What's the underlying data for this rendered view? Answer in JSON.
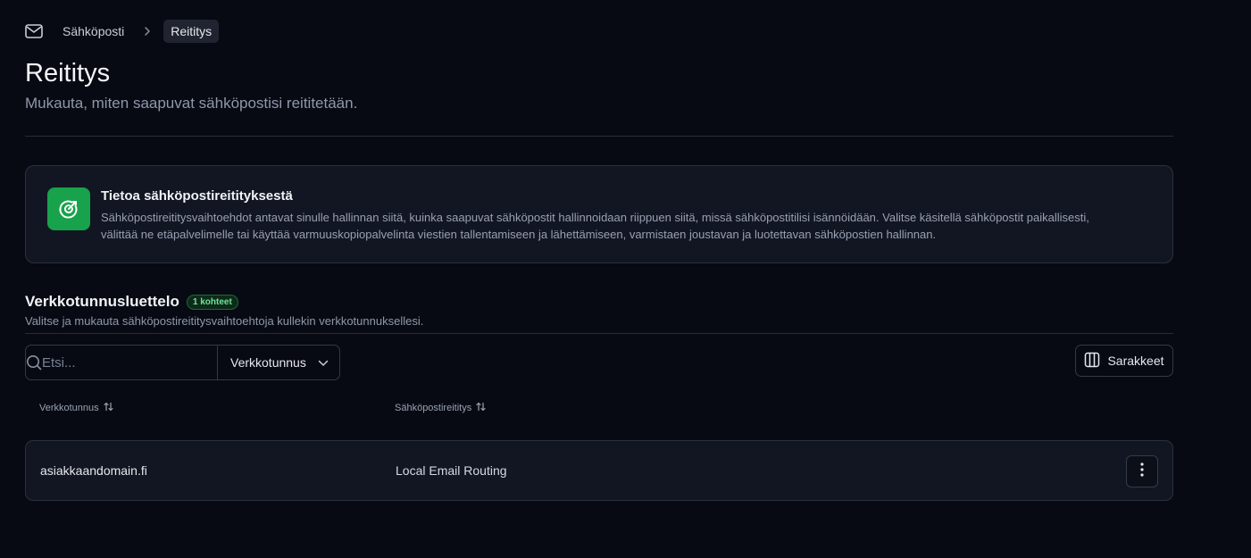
{
  "breadcrumb": {
    "icon": "mail-icon",
    "parent": "Sähköposti",
    "current": "Reititys"
  },
  "header": {
    "title": "Reititys",
    "subtitle": "Mukauta, miten saapuvat sähköpostisi reititetään."
  },
  "info": {
    "icon": "target-icon",
    "title": "Tietoa sähköpostireitityksestä",
    "text": "Sähköpostireititysvaihtoehdot antavat sinulle hallinnan siitä, kuinka saapuvat sähköpostit hallinnoidaan riippuen siitä, missä sähköpostitilisi isännöidään. Valitse käsitellä sähköpostit paikallisesti, välittää ne etäpalvelimelle tai käyttää varmuuskopiopalvelinta viestien tallentamiseen ja lähettämiseen, varmistaen joustavan ja luotettavan sähköpostien hallinnan."
  },
  "section": {
    "title": "Verkkotunnusluettelo",
    "badge": "1 kohteet",
    "subtitle": "Valitse ja mukauta sähköpostireititysvaihtoehtoja kullekin verkkotunnuksellesi."
  },
  "toolbar": {
    "search_placeholder": "Etsi...",
    "filter_label": "Verkkotunnus",
    "columns_label": "Sarakkeet"
  },
  "table": {
    "columns": [
      "Verkkotunnus",
      "Sähköpostireititys"
    ],
    "rows": [
      {
        "domain": "asiakkaandomain.fi",
        "routing": "Local Email Routing"
      }
    ]
  },
  "colors": {
    "background": "#070a13",
    "card": "#121622",
    "accent_green": "#18a24b",
    "badge_green": "#6fe39a"
  }
}
